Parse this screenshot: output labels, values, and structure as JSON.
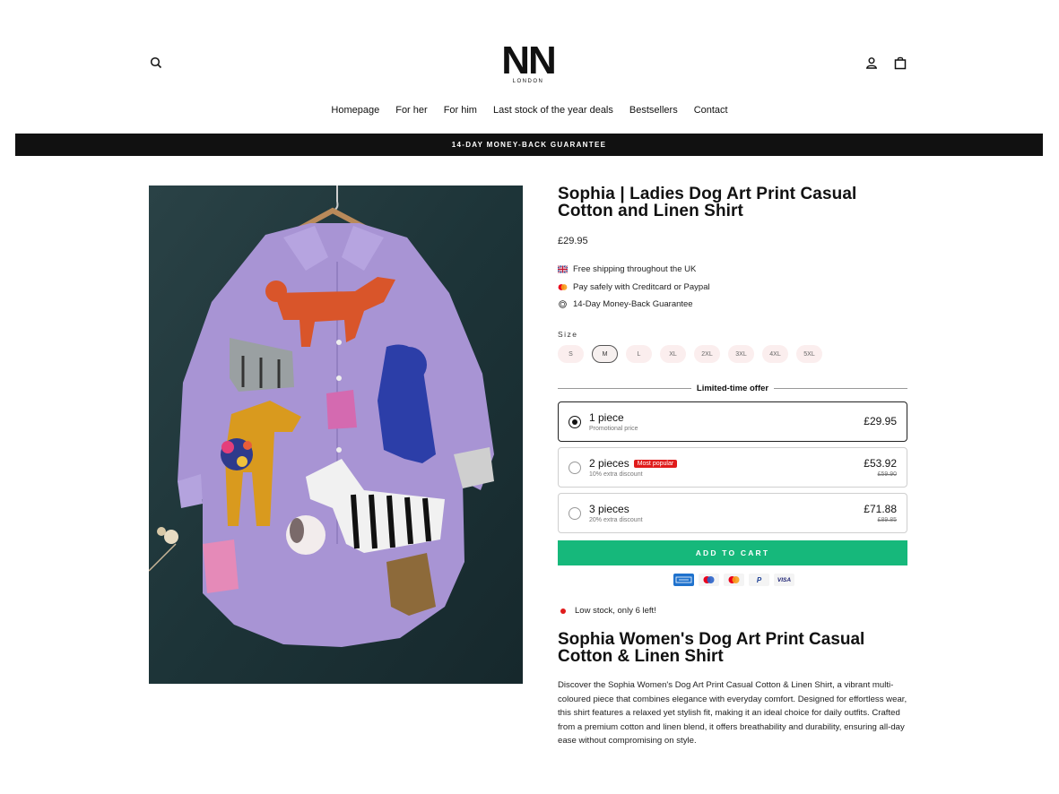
{
  "header": {
    "logo_text": "NN",
    "logo_sub": "LONDON",
    "icons": [
      "search-icon",
      "account-icon",
      "cart-icon"
    ]
  },
  "nav": {
    "items": [
      "Homepage",
      "For her",
      "For him",
      "Last stock of the year deals",
      "Bestsellers",
      "Contact"
    ]
  },
  "banner": {
    "text": "14-DAY MONEY-BACK GUARANTEE"
  },
  "product": {
    "title": "Sophia | Ladies Dog Art Print Casual Cotton and Linen Shirt",
    "price": "£29.95",
    "perks": [
      {
        "icon": "uk-flag-icon",
        "text": "Free shipping throughout the UK"
      },
      {
        "icon": "mastercard-icon",
        "text": "Pay safely with Creditcard or Paypal"
      },
      {
        "icon": "guarantee-badge-icon",
        "text": "14-Day Money-Back Guarantee"
      }
    ],
    "size_label": "Size",
    "sizes": [
      "S",
      "M",
      "L",
      "XL",
      "2XL",
      "3XL",
      "4XL",
      "5XL"
    ],
    "selected_size": "M",
    "offer_heading": "Limited-time offer",
    "options": [
      {
        "title": "1 piece",
        "subtitle": "Promotional price",
        "price": "£29.95",
        "old_price": "",
        "badge": ""
      },
      {
        "title": "2 pieces",
        "subtitle": "10% extra discount",
        "price": "£53.92",
        "old_price": "£59.90",
        "badge": "Most popular"
      },
      {
        "title": "3 pieces",
        "subtitle": "20% extra discount",
        "price": "£71.88",
        "old_price": "£89.85",
        "badge": ""
      }
    ],
    "selected_option": 0,
    "add_to_cart": "ADD TO CART",
    "payment_methods": [
      "AMEX",
      "maestro",
      "mastercard",
      "P",
      "VISA"
    ],
    "stock_text": "Low stock, only 6 left!",
    "description_title": "Sophia Women's Dog Art Print Casual Cotton & Linen Shirt",
    "description": "Discover the Sophia Women's Dog Art Print Casual Cotton & Linen Shirt, a vibrant multi-coloured piece that combines elegance with everyday comfort. Designed for effortless wear, this shirt features a relaxed yet stylish fit, making it an ideal choice for daily outfits. Crafted from a premium cotton and linen blend, it offers breathability and durability, ensuring all-day ease without compromising on style."
  },
  "colors": {
    "accent_green": "#16b87b",
    "badge_red": "#e01b1b",
    "banner_bg": "#111111",
    "shirt_lavender": "#a894d4"
  }
}
